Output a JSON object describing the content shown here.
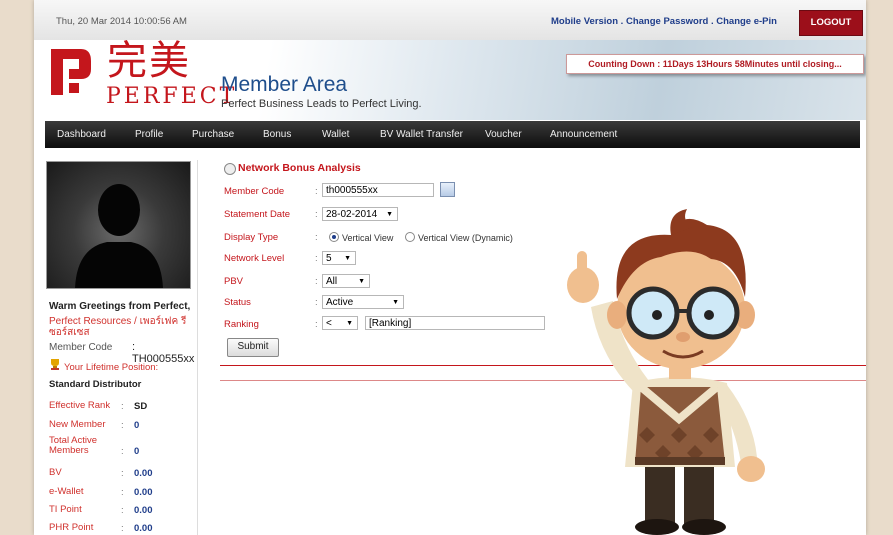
{
  "topbar": {
    "datetime": "Thu, 20 Mar 2014  10:00:56 AM",
    "links": [
      "Mobile Version",
      "Change Password",
      "Change e-Pin"
    ],
    "separator": " . ",
    "logout": "LOGOUT"
  },
  "brand": {
    "logo_cn": "完美",
    "logo_en": "PERFECT",
    "title": "Member Area",
    "tagline": "Perfect Business Leads to Perfect Living.",
    "countdown": "Counting Down : 11Days 13Hours 58Minutes until closing..."
  },
  "nav": [
    "Dashboard",
    "Profile",
    "Purchase",
    "Bonus",
    "Wallet",
    "BV Wallet Transfer",
    "Voucher",
    "Announcement"
  ],
  "sidebar": {
    "greeting": "Warm Greetings from Perfect,",
    "resources": "Perfect Resources / เพอร์เฟค รีซอร์สเซส",
    "member_code_label": "Member Code",
    "member_code_value": ": TH000555xx",
    "lifetime_label": "Your Lifetime Position:",
    "distributor": "Standard Distributor",
    "stats": [
      {
        "label": "Effective Rank",
        "value": "SD"
      },
      {
        "label": "New Member",
        "value": "0"
      },
      {
        "label": "Total Active Members",
        "value": "0"
      },
      {
        "label": "BV",
        "value": "0.00"
      },
      {
        "label": "e-Wallet",
        "value": "0.00"
      },
      {
        "label": "TI Point",
        "value": "0.00"
      },
      {
        "label": "PHR Point",
        "value": "0.00"
      }
    ]
  },
  "form": {
    "title": "Network Bonus Analysis",
    "member_code_label": "Member Code",
    "member_code_value": "th000555xx",
    "statement_date_label": "Statement Date",
    "statement_date_value": "28-02-2014",
    "display_type_label": "Display Type",
    "display_options": [
      "Vertical View",
      "Vertical View (Dynamic)"
    ],
    "network_level_label": "Network Level",
    "network_level_value": "5",
    "pbv_label": "PBV",
    "pbv_value": "All",
    "status_label": "Status",
    "status_value": "Active",
    "ranking_label": "Ranking",
    "ranking_operator": "<",
    "ranking_value": "[Ranking]",
    "submit": "Submit",
    "colon": ":"
  },
  "colors": {
    "brand_red": "#c4161c",
    "link_blue": "#1f3d8a",
    "logout_bg": "#9c0f1a",
    "nav_bg": "#111111"
  },
  "icons": [
    "logo-mark-icon",
    "trophy-icon",
    "lookup-icon",
    "section-bullet-icon",
    "dropdown-arrow-icon"
  ]
}
